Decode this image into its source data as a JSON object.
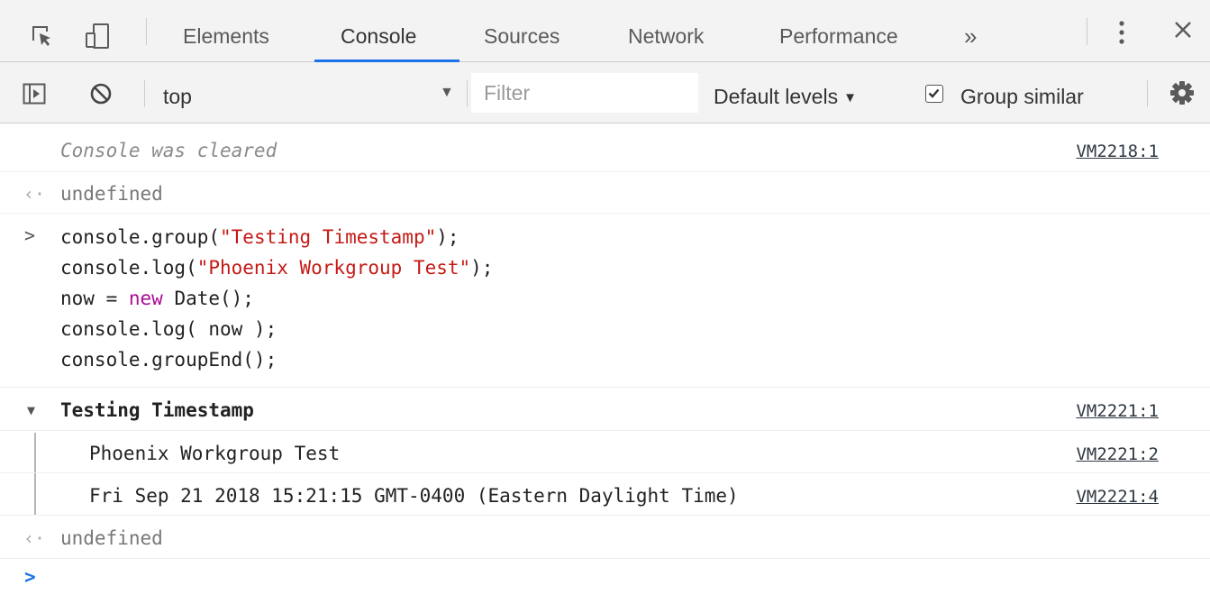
{
  "tabs": {
    "items": [
      {
        "label": "Elements"
      },
      {
        "label": "Console"
      },
      {
        "label": "Sources"
      },
      {
        "label": "Network"
      },
      {
        "label": "Performance"
      }
    ],
    "active": "Console",
    "overflow": "»"
  },
  "toolbar": {
    "context": "top",
    "filter_placeholder": "Filter",
    "levels": "Default levels",
    "group_similar": "Group similar",
    "group_similar_checked": true
  },
  "console": {
    "cleared_message": "Console was cleared",
    "cleared_link": "VM2218:1",
    "return_value_1": "undefined",
    "code": {
      "l1_a": "console.group(",
      "l1_s": "\"Testing Timestamp\"",
      "l1_b": ");",
      "l2_a": "console.log(",
      "l2_s": "\"Phoenix Workgroup Test\"",
      "l2_b": ");",
      "l3_a": "now = ",
      "l3_kw": "new",
      "l3_b": " Date();",
      "l4": "console.log( now );",
      "l5": "console.groupEnd();"
    },
    "group": {
      "title": "Testing Timestamp",
      "link": "VM2221:1",
      "entries": [
        {
          "text": "Phoenix Workgroup Test",
          "link": "VM2221:2"
        },
        {
          "text": "Fri Sep 21 2018 15:21:15 GMT-0400 (Eastern Daylight Time)",
          "link": "VM2221:4"
        }
      ]
    },
    "return_value_2": "undefined"
  },
  "colors": {
    "accent": "#1a73e8",
    "string": "#c41a16",
    "keyword": "#aa0d91",
    "toolbar_bg": "#f3f3f3"
  },
  "icons": [
    "inspect-element-icon",
    "device-toggle-icon",
    "kebab-menu-icon",
    "close-icon",
    "sidebar-toggle-icon",
    "clear-console-icon",
    "gear-icon",
    "return-arrow-icon",
    "prompt-chevron-icon",
    "collapse-triangle-icon"
  ]
}
